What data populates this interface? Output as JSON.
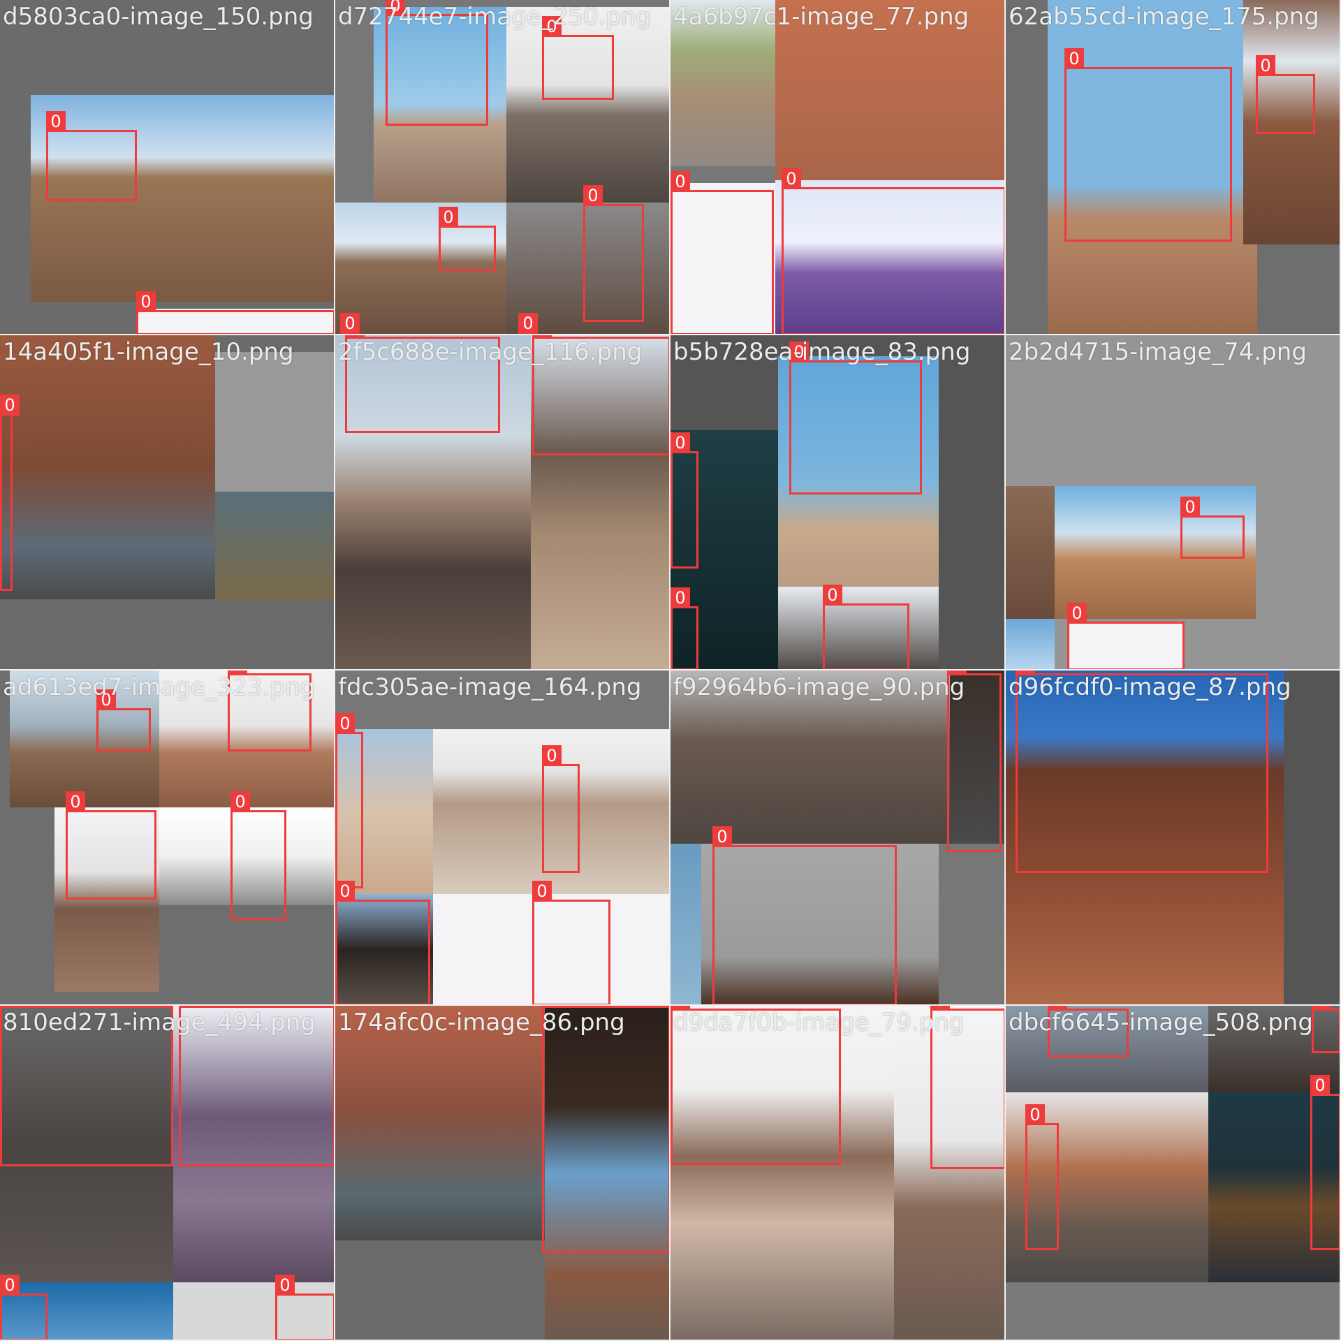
{
  "tiles": [
    {
      "caption": "d5803ca0-image_150.png"
    },
    {
      "caption": "d72744e7-image_250.png"
    },
    {
      "caption": "4a6b97c1-image_77.png"
    },
    {
      "caption": "62ab55cd-image_175.png"
    },
    {
      "caption": "14a405f1-image_10.png"
    },
    {
      "caption": "2f5c688e-image_116.png"
    },
    {
      "caption": "b5b728ea-image_83.png"
    },
    {
      "caption": "2b2d4715-image_74.png"
    },
    {
      "caption": "ad613ed7-image_323.png"
    },
    {
      "caption": "fdc305ae-image_164.png"
    },
    {
      "caption": "f92964b6-image_90.png"
    },
    {
      "caption": "d96fcdf0-image_87.png"
    },
    {
      "caption": "810ed271-image_494.png"
    },
    {
      "caption": "174afc0c-image_86.png"
    },
    {
      "caption": "d9da7f0b-image_79.png"
    },
    {
      "caption": "dbcf6645-image_508.png"
    }
  ],
  "box_label": "0",
  "colors": {
    "box": "#ee3b3b",
    "caption": "#ececec",
    "separator": "#f2f2f2"
  }
}
